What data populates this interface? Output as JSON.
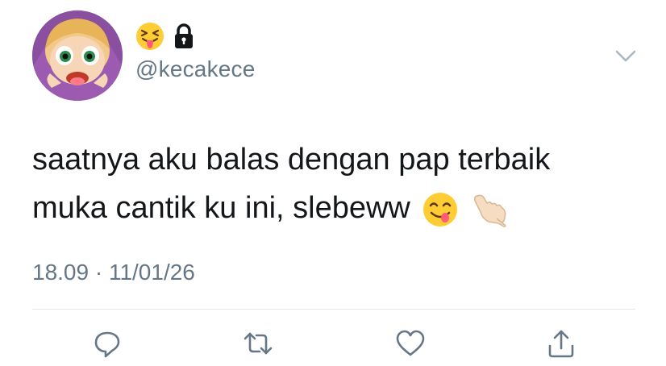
{
  "user": {
    "handle": "@kecakece",
    "name_icons": [
      "squinting-tongue-emoji-icon",
      "lock-icon"
    ]
  },
  "tweet": {
    "line1": "saatnya aku balas dengan pap terbaik",
    "line2": "muka cantik ku ini, slebeww",
    "emojis": [
      "yum-face-emoji-icon",
      "call-me-hand-emoji-icon"
    ],
    "timestamp": "18.09 · 11/01/26"
  },
  "actions": [
    "reply-icon",
    "retweet-icon",
    "like-icon",
    "share-icon"
  ],
  "colors": {
    "text": "#14171a",
    "secondary": "#657786",
    "divider": "#e1e8ed",
    "icon": "#657786"
  }
}
